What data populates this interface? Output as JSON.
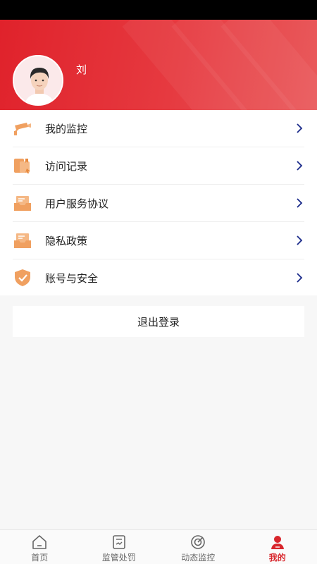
{
  "colors": {
    "primary_red": "#e0222b",
    "icon_orange": "#f0a060",
    "chevron_blue": "#1a2a8a",
    "tab_inactive": "#666666",
    "tab_active": "#d8262c"
  },
  "profile": {
    "name": "刘"
  },
  "menu": {
    "items": [
      {
        "label": "我的监控",
        "icon": "camera-icon"
      },
      {
        "label": "访问记录",
        "icon": "folder-icon"
      },
      {
        "label": "用户服务协议",
        "icon": "document-tray-icon"
      },
      {
        "label": "隐私政策",
        "icon": "document-tray-icon"
      },
      {
        "label": "账号与安全",
        "icon": "shield-check-icon"
      }
    ]
  },
  "logout": {
    "label": "退出登录"
  },
  "tabbar": {
    "tabs": [
      {
        "label": "首页",
        "icon": "home-icon",
        "active": false
      },
      {
        "label": "监管处罚",
        "icon": "clipboard-icon",
        "active": false
      },
      {
        "label": "动态监控",
        "icon": "radar-icon",
        "active": false
      },
      {
        "label": "我的",
        "icon": "person-icon",
        "active": true
      }
    ]
  }
}
